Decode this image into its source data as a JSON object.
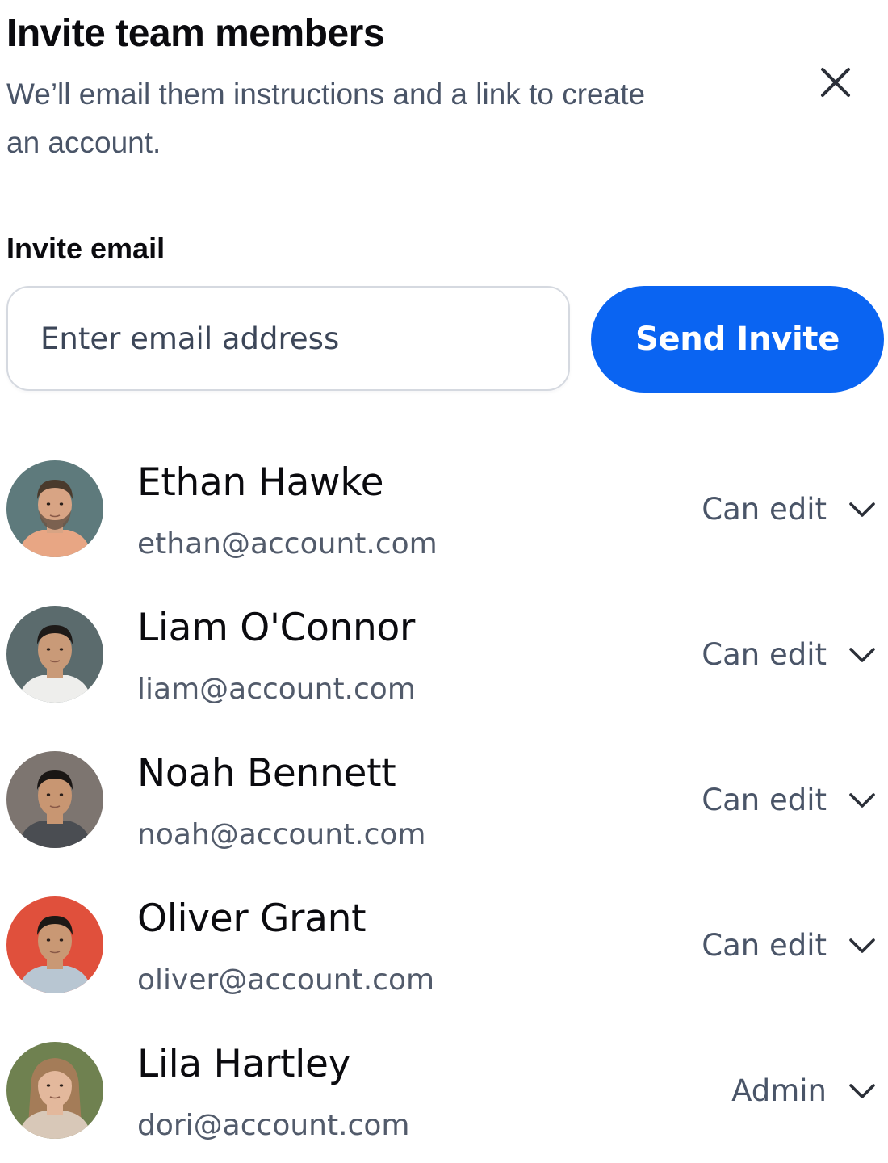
{
  "header": {
    "title": "Invite team members",
    "subtitle": "We’ll email them instructions and a link to create an account."
  },
  "close_icon": "close-icon",
  "invite": {
    "label": "Invite email",
    "placeholder": "Enter email address",
    "value": "",
    "send_label": "Send Invite"
  },
  "colors": {
    "accent": "#0a64f2",
    "text_primary": "#0b0b0f",
    "text_secondary": "#4a5568"
  },
  "members": [
    {
      "name": "Ethan Hawke",
      "email": "ethan@account.com",
      "role": "Can edit",
      "avatar_bg": "#5e7a7c",
      "skin": "#d8a484",
      "hair": "#4a3a2c",
      "shirt": "#e8a684",
      "beard": true
    },
    {
      "name": "Liam O'Connor",
      "email": "liam@account.com",
      "role": "Can edit",
      "avatar_bg": "#5b6b6d",
      "skin": "#c99a78",
      "hair": "#1e1a18",
      "shirt": "#eeeeec",
      "beard": false
    },
    {
      "name": "Noah Bennett",
      "email": "noah@account.com",
      "role": "Can edit",
      "avatar_bg": "#7d7570",
      "skin": "#c89672",
      "hair": "#1a1614",
      "shirt": "#4a4d52",
      "beard": false
    },
    {
      "name": "Oliver Grant",
      "email": "oliver@account.com",
      "role": "Can edit",
      "avatar_bg": "#e0503c",
      "skin": "#c99874",
      "hair": "#1c1916",
      "shirt": "#b8c6d2",
      "beard": false
    },
    {
      "name": "Lila Hartley",
      "email": "dori@account.com",
      "role": "Admin",
      "avatar_bg": "#6f8150",
      "skin": "#e3b89c",
      "hair": "#a47c58",
      "shirt": "#d8c8b8",
      "beard": false
    }
  ]
}
